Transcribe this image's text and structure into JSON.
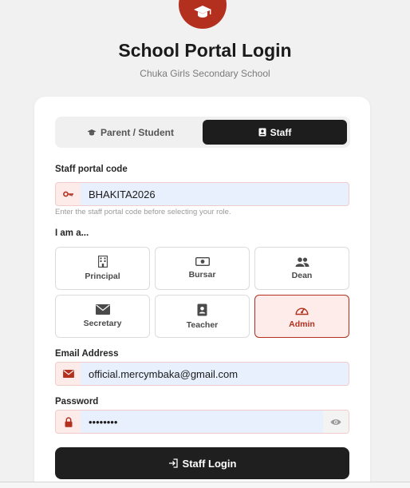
{
  "header": {
    "title": "School Portal Login",
    "subtitle": "Chuka Girls Secondary School"
  },
  "tabs": [
    {
      "label": "Parent / Student",
      "icon": "graduation-cap-icon",
      "active": false
    },
    {
      "label": "Staff",
      "icon": "id-badge-icon",
      "active": true
    }
  ],
  "staff_code": {
    "label": "Staff portal code",
    "value": "BHAKITA2026",
    "hint": "Enter the staff portal code before selecting your role."
  },
  "roles": {
    "label": "I am a...",
    "items": [
      {
        "label": "Principal",
        "icon": "building-icon"
      },
      {
        "label": "Bursar",
        "icon": "money-icon"
      },
      {
        "label": "Dean",
        "icon": "users-icon"
      },
      {
        "label": "Secretary",
        "icon": "envelope-icon"
      },
      {
        "label": "Teacher",
        "icon": "id-badge-icon"
      },
      {
        "label": "Admin",
        "icon": "gauge-icon",
        "active": true
      }
    ]
  },
  "email": {
    "label": "Email Address",
    "value": "official.mercymbaka@gmail.com"
  },
  "password": {
    "label": "Password",
    "value": "••••••••"
  },
  "login_button": {
    "label": "Staff Login"
  },
  "colors": {
    "accent": "#b3301f",
    "dark": "#1d1d1d",
    "autofill": "#e8f0fe"
  }
}
